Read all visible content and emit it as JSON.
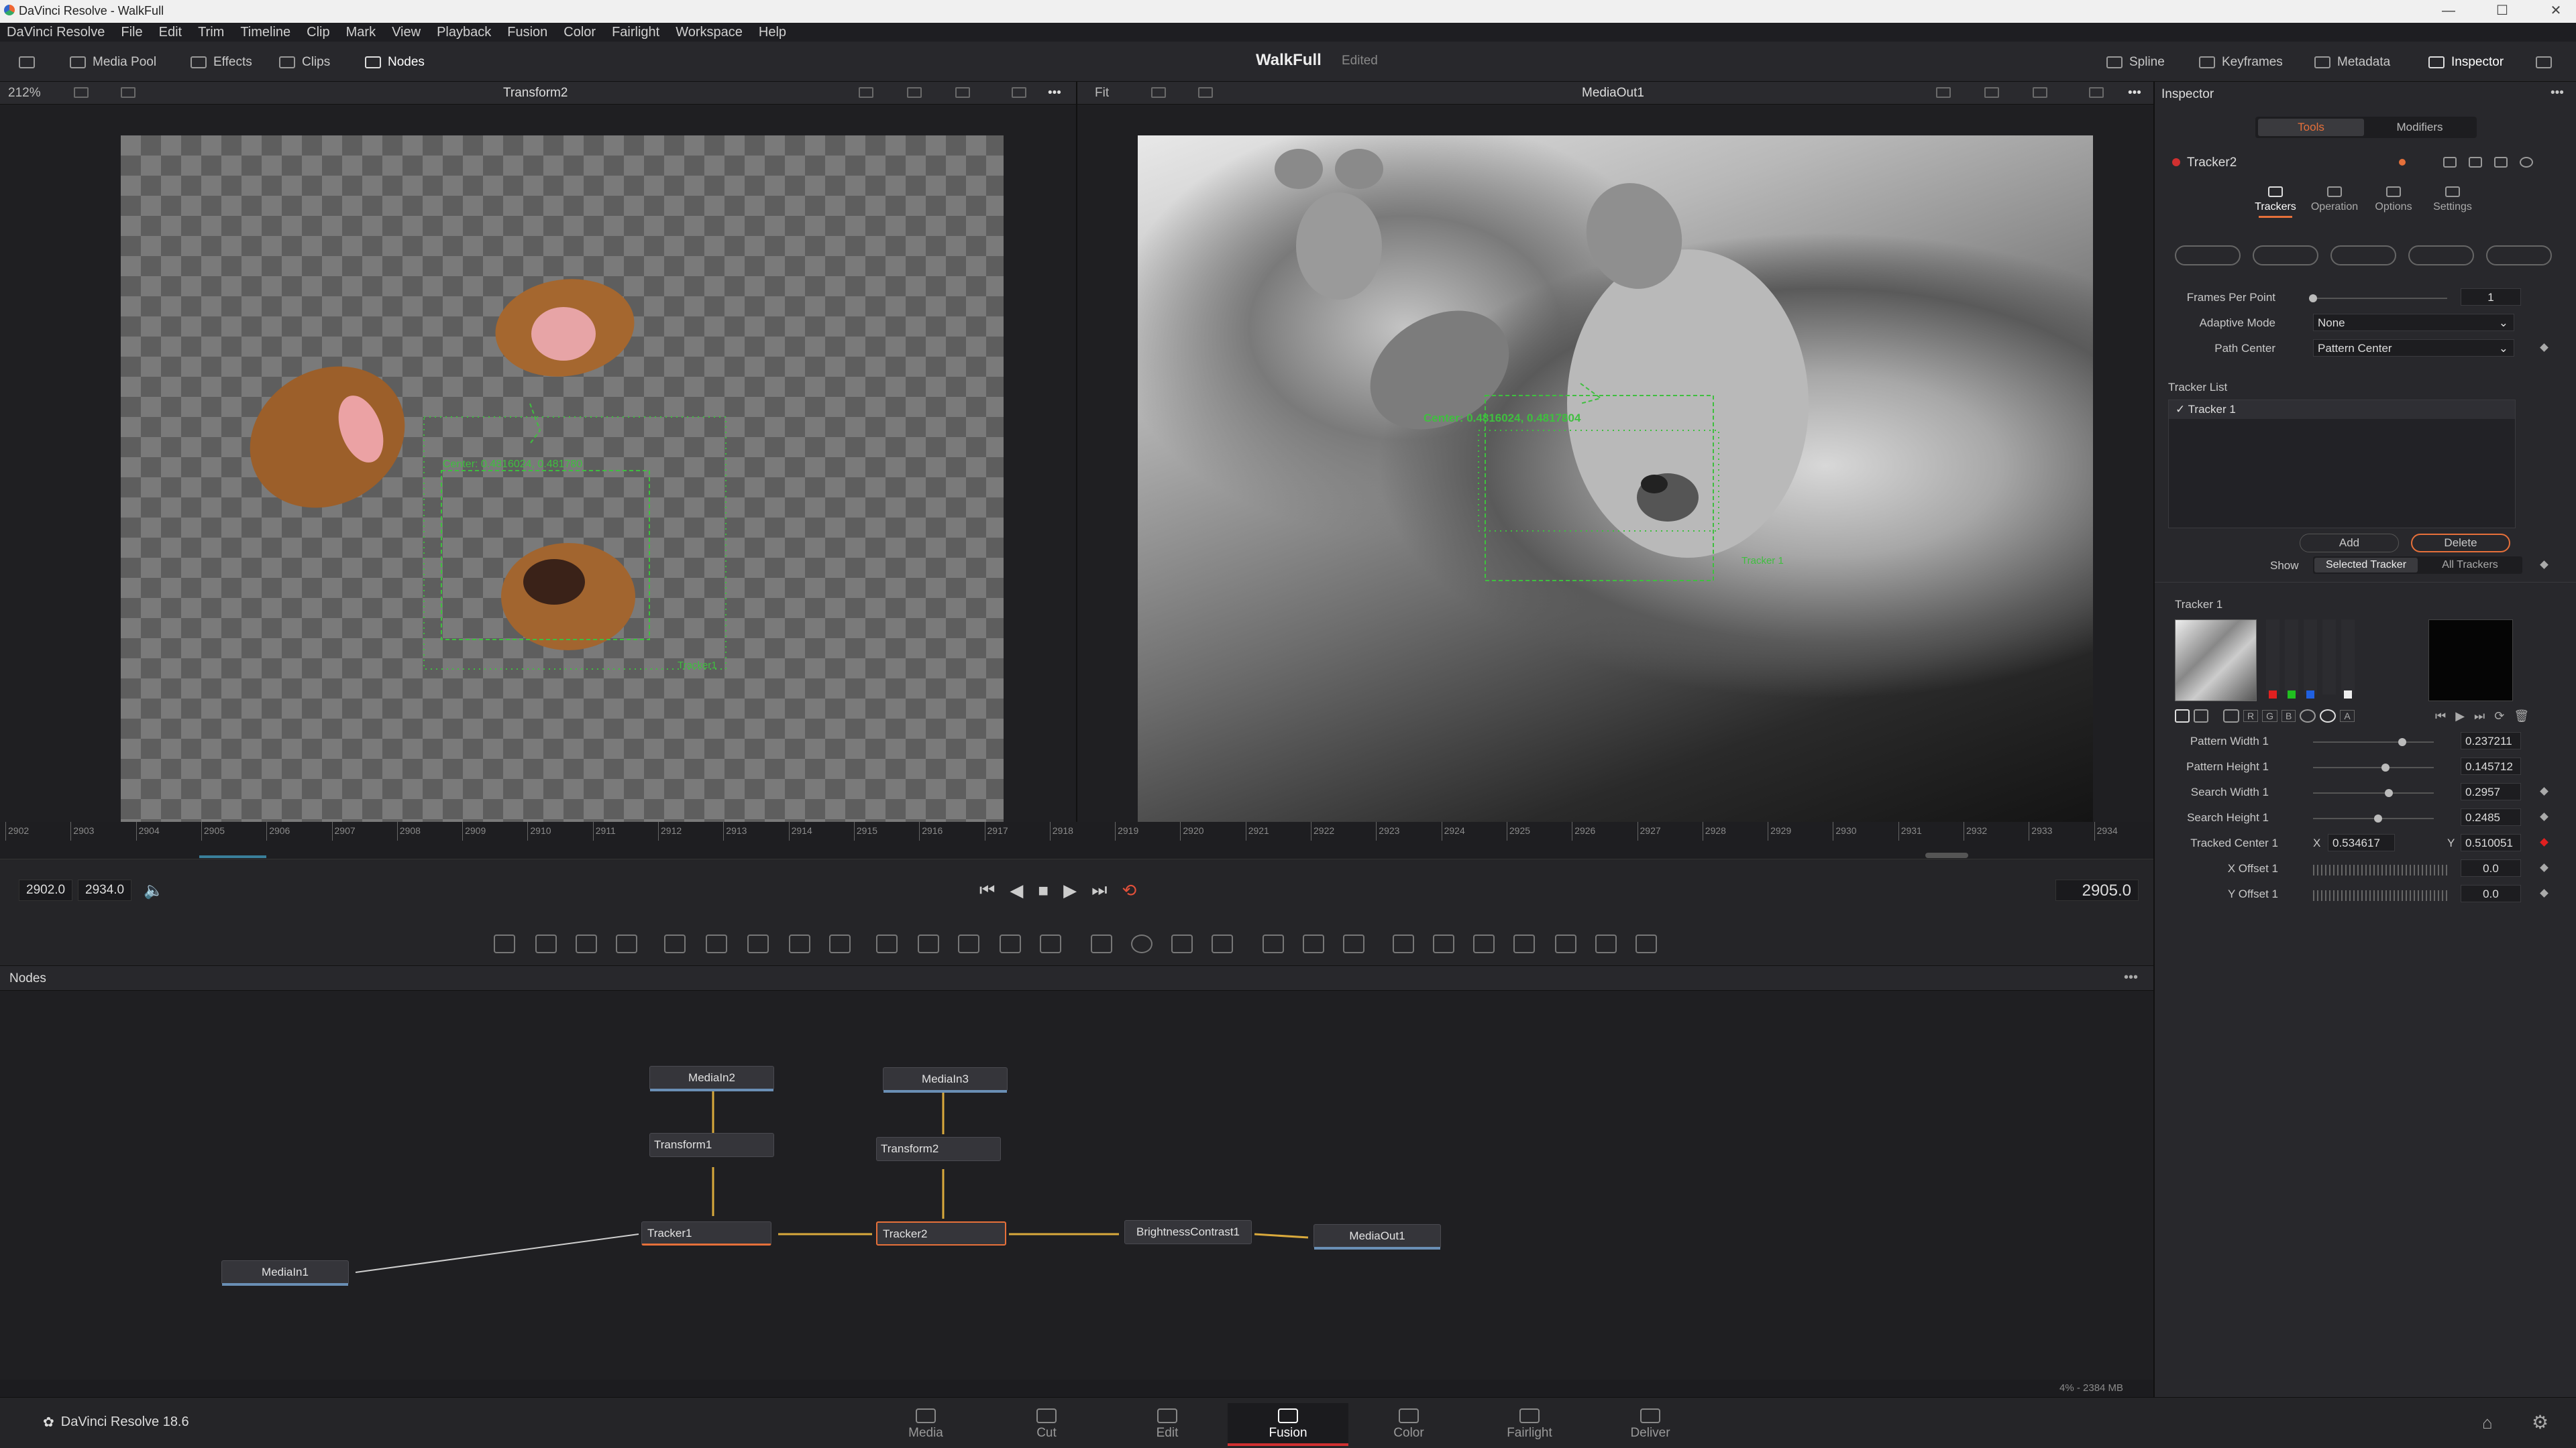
{
  "window": {
    "title": "DaVinci Resolve - WalkFull"
  },
  "menu": [
    "DaVinci Resolve",
    "File",
    "Edit",
    "Trim",
    "Timeline",
    "Clip",
    "Mark",
    "View",
    "Playback",
    "Fusion",
    "Color",
    "Fairlight",
    "Workspace",
    "Help"
  ],
  "toolbar": {
    "media_pool": "Media Pool",
    "effects": "Effects",
    "clips": "Clips",
    "nodes": "Nodes",
    "project_title": "WalkFull",
    "project_status": "Edited",
    "spline": "Spline",
    "keyframes": "Keyframes",
    "metadata": "Metadata",
    "inspector": "Inspector"
  },
  "viewer_left": {
    "zoom": "212%",
    "name": "Transform2",
    "tracker_overlay": "Center: 0.4816024, 0.481780",
    "corner_label": "Tracker1"
  },
  "viewer_right": {
    "zoom": "Fit",
    "name": "MediaOut1",
    "tracker_overlay": "Center: 0.4816024, 0.4817804",
    "corner_label": "Tracker 1"
  },
  "timeline": {
    "ticks": [
      "2902",
      "2903",
      "2904",
      "2905",
      "2906",
      "2907",
      "2908",
      "2909",
      "2910",
      "2911",
      "2912",
      "2913",
      "2914",
      "2915",
      "2916",
      "2917",
      "2918",
      "2919",
      "2920",
      "2921",
      "2922",
      "2923",
      "2924",
      "2925",
      "2926",
      "2927",
      "2928",
      "2929",
      "2930",
      "2931",
      "2932",
      "2933",
      "2934"
    ],
    "start": "2902.0",
    "end": "2934.0",
    "current": "2905.0"
  },
  "nodes_panel": {
    "title": "Nodes",
    "nodes": {
      "mediain2": "MediaIn2",
      "mediain3": "MediaIn3",
      "transform1": "Transform1",
      "transform2": "Transform2",
      "tracker1": "Tracker1",
      "tracker2": "Tracker2",
      "brightness": "BrightnessContrast1",
      "mediaout1": "MediaOut1",
      "mediain1": "MediaIn1"
    }
  },
  "status": {
    "memory": "4% - 2384 MB"
  },
  "bottom": {
    "app_name": "DaVinci Resolve 18.6",
    "pages": [
      "Media",
      "Cut",
      "Edit",
      "Fusion",
      "Color",
      "Fairlight",
      "Deliver"
    ],
    "active_page": "Fusion"
  },
  "inspector": {
    "title": "Inspector",
    "tab_tools": "Tools",
    "tab_modifiers": "Modifiers",
    "node_name": "Tracker2",
    "subtabs": [
      "Trackers",
      "Operation",
      "Options",
      "Settings"
    ],
    "frames_per_point_label": "Frames Per Point",
    "frames_per_point_value": "1",
    "adaptive_mode_label": "Adaptive Mode",
    "adaptive_mode_value": "None",
    "path_center_label": "Path Center",
    "path_center_value": "Pattern Center",
    "tracker_list_label": "Tracker List",
    "tracker_list_items": [
      "Tracker 1"
    ],
    "add_button": "Add",
    "delete_button": "Delete",
    "show_label": "Show",
    "show_selected": "Selected Tracker",
    "show_all": "All Trackers",
    "tracker_section": "Tracker 1",
    "channel_buttons": [
      "R",
      "G",
      "B",
      "A"
    ],
    "params": [
      {
        "label": "Pattern Width 1",
        "value": "0.237211",
        "level": 0.74
      },
      {
        "label": "Pattern Height 1",
        "value": "0.145712",
        "level": 0.6
      },
      {
        "label": "Search Width 1",
        "value": "0.2957",
        "level": 0.63
      },
      {
        "label": "Search Height 1",
        "value": "0.2485",
        "level": 0.54
      }
    ],
    "tracked_center_label": "Tracked Center 1",
    "tracked_center_x_label": "X",
    "tracked_center_x": "0.534617",
    "tracked_center_y_label": "Y",
    "tracked_center_y": "0.510051",
    "x_offset_label": "X Offset 1",
    "x_offset_value": "0.0",
    "y_offset_label": "Y Offset 1",
    "y_offset_value": "0.0"
  },
  "colors": {
    "accent": "#e6703a",
    "node_selected": "#e6703a",
    "tracker_green": "#3fbf3f",
    "connection": "#e6b84a"
  }
}
